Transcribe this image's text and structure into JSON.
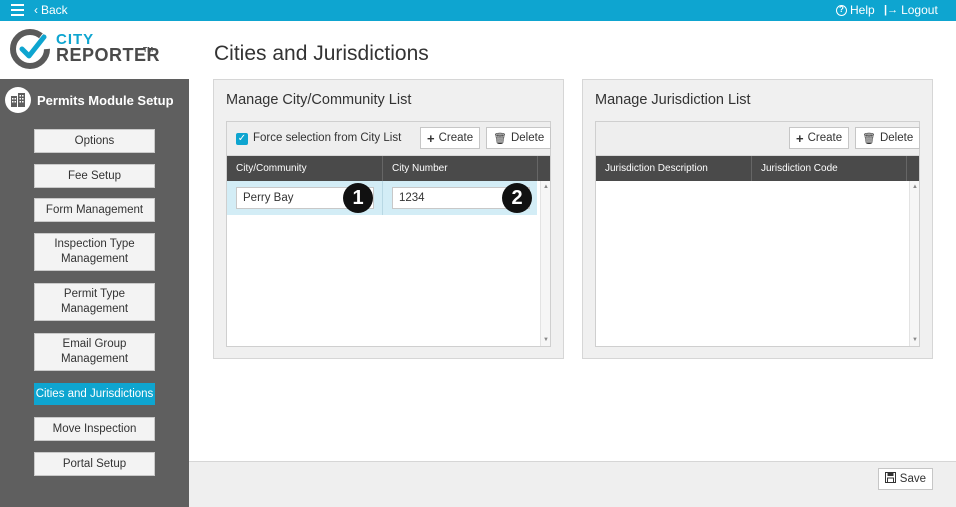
{
  "topbar": {
    "back_label": "Back",
    "help_label": "Help",
    "logout_label": "Logout"
  },
  "brand": {
    "line1": "CITY",
    "line2": "REPORTER",
    "tm": "TM"
  },
  "sidebar": {
    "header": "Permits Module Setup",
    "items": [
      {
        "label": "Options"
      },
      {
        "label": "Fee Setup"
      },
      {
        "label": "Form Management"
      },
      {
        "label": "Inspection Type Management"
      },
      {
        "label": "Permit Type Management"
      },
      {
        "label": "Email Group Management"
      },
      {
        "label": "Cities and Jurisdictions",
        "active": true
      },
      {
        "label": "Move Inspection"
      },
      {
        "label": "Portal Setup"
      }
    ]
  },
  "page": {
    "title": "Cities and Jurisdictions"
  },
  "city_panel": {
    "title": "Manage City/Community List",
    "checkbox_label": "Force selection from City List",
    "create_label": "Create",
    "delete_label": "Delete",
    "columns": [
      "City/Community",
      "City Number"
    ],
    "rows": [
      {
        "city": "Perry Bay",
        "number": "1234"
      }
    ],
    "badges": [
      "1",
      "2"
    ]
  },
  "jurisdiction_panel": {
    "title": "Manage Jurisdiction List",
    "create_label": "Create",
    "delete_label": "Delete",
    "columns": [
      "Jurisdiction Description",
      "Jurisdiction Code"
    ]
  },
  "footer": {
    "save_label": "Save"
  },
  "colors": {
    "accent": "#0ea5d0",
    "sidebar": "#5f5f5f",
    "header_dark": "#4a4a4a",
    "row_selected": "#d3edf6"
  }
}
